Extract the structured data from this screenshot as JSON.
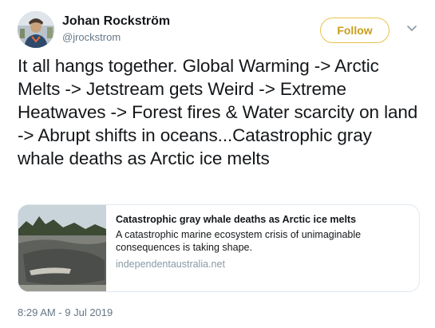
{
  "author": {
    "name": "Johan Rockström",
    "handle": "@jrockstrom"
  },
  "actions": {
    "follow_label": "Follow",
    "more_icon": "chevron-down-icon"
  },
  "tweet": {
    "text": "It all hangs together. Global Warming -> Arctic Melts -> Jetstream gets Weird -> Extreme Heatwaves -> Forest fires & Water scarcity on land -> Abrupt shifts in oceans...Catastrophic gray whale deaths as Arctic ice melts",
    "timestamp": "8:29 AM - 9 Jul 2019"
  },
  "card": {
    "title": "Catastrophic gray whale deaths as Arctic ice melts",
    "description": "A catastrophic marine ecosystem crisis of unimaginable consequences is taking shape.",
    "domain": "independentaustralia.net"
  },
  "colors": {
    "follow_accent": "#c99d1c",
    "follow_border": "#e8c24a",
    "muted_text": "#657786",
    "card_border": "#e1e8ed"
  }
}
